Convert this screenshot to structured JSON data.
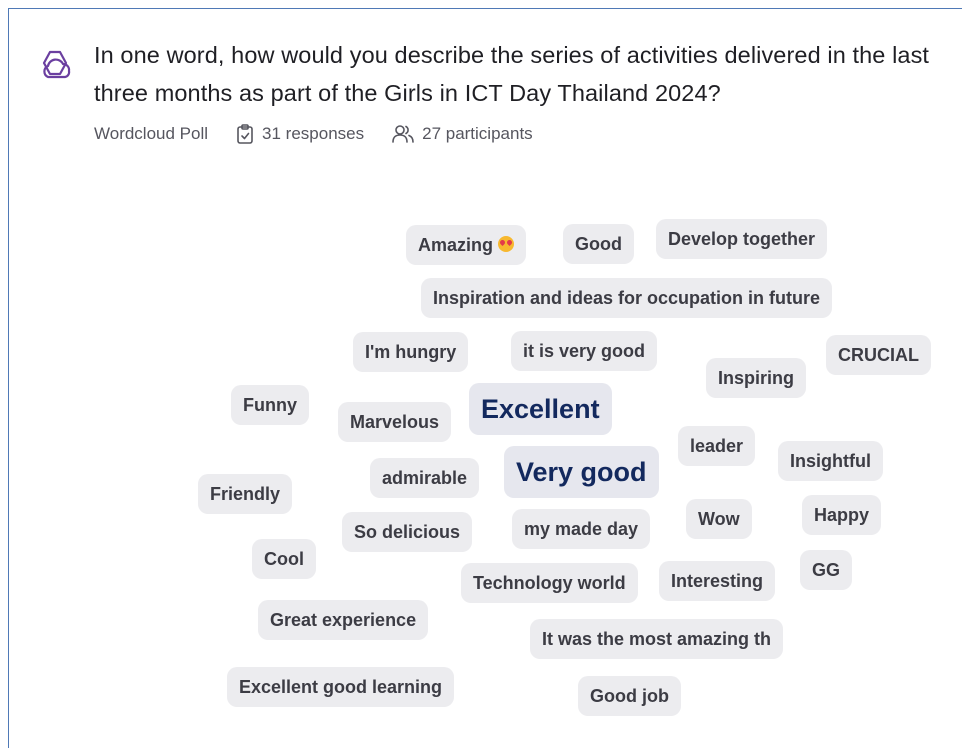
{
  "question": "In one word, how would you describe the series of activities delivered in the last three months as part of the Girls in ICT Day Thailand 2024?",
  "meta": {
    "poll_type": "Wordcloud Poll",
    "responses": "31 responses",
    "participants": "27 participants"
  },
  "colors": {
    "accent": "#6b3fa0",
    "chip_bg": "#ececef",
    "chip_text": "#3c3c44",
    "highlight_text": "#13295e",
    "frame_border": "#4f79b6"
  },
  "words": {
    "w1": "Amazing",
    "w2": "Good",
    "w3": "Develop together",
    "w4": "Inspiration and ideas for occupation in future",
    "w5": "I'm hungry",
    "w6": "it is very good",
    "w7": "CRUCIAL",
    "w8": "Inspiring",
    "w9": "Funny",
    "w10": "Marvelous",
    "w11": "Excellent",
    "w12": "leader",
    "w13": "Insightful",
    "w14": "admirable",
    "w15": "Very good",
    "w16": "Friendly",
    "w17": "So delicious",
    "w18": "my made day",
    "w19": "Wow",
    "w20": "Happy",
    "w21": "Cool",
    "w22": "Technology world",
    "w23": "Interesting",
    "w24": "GG",
    "w25": "Great experience",
    "w26": "It was the most amazing th",
    "w27": "Excellent good learning",
    "w28": "Good job"
  }
}
